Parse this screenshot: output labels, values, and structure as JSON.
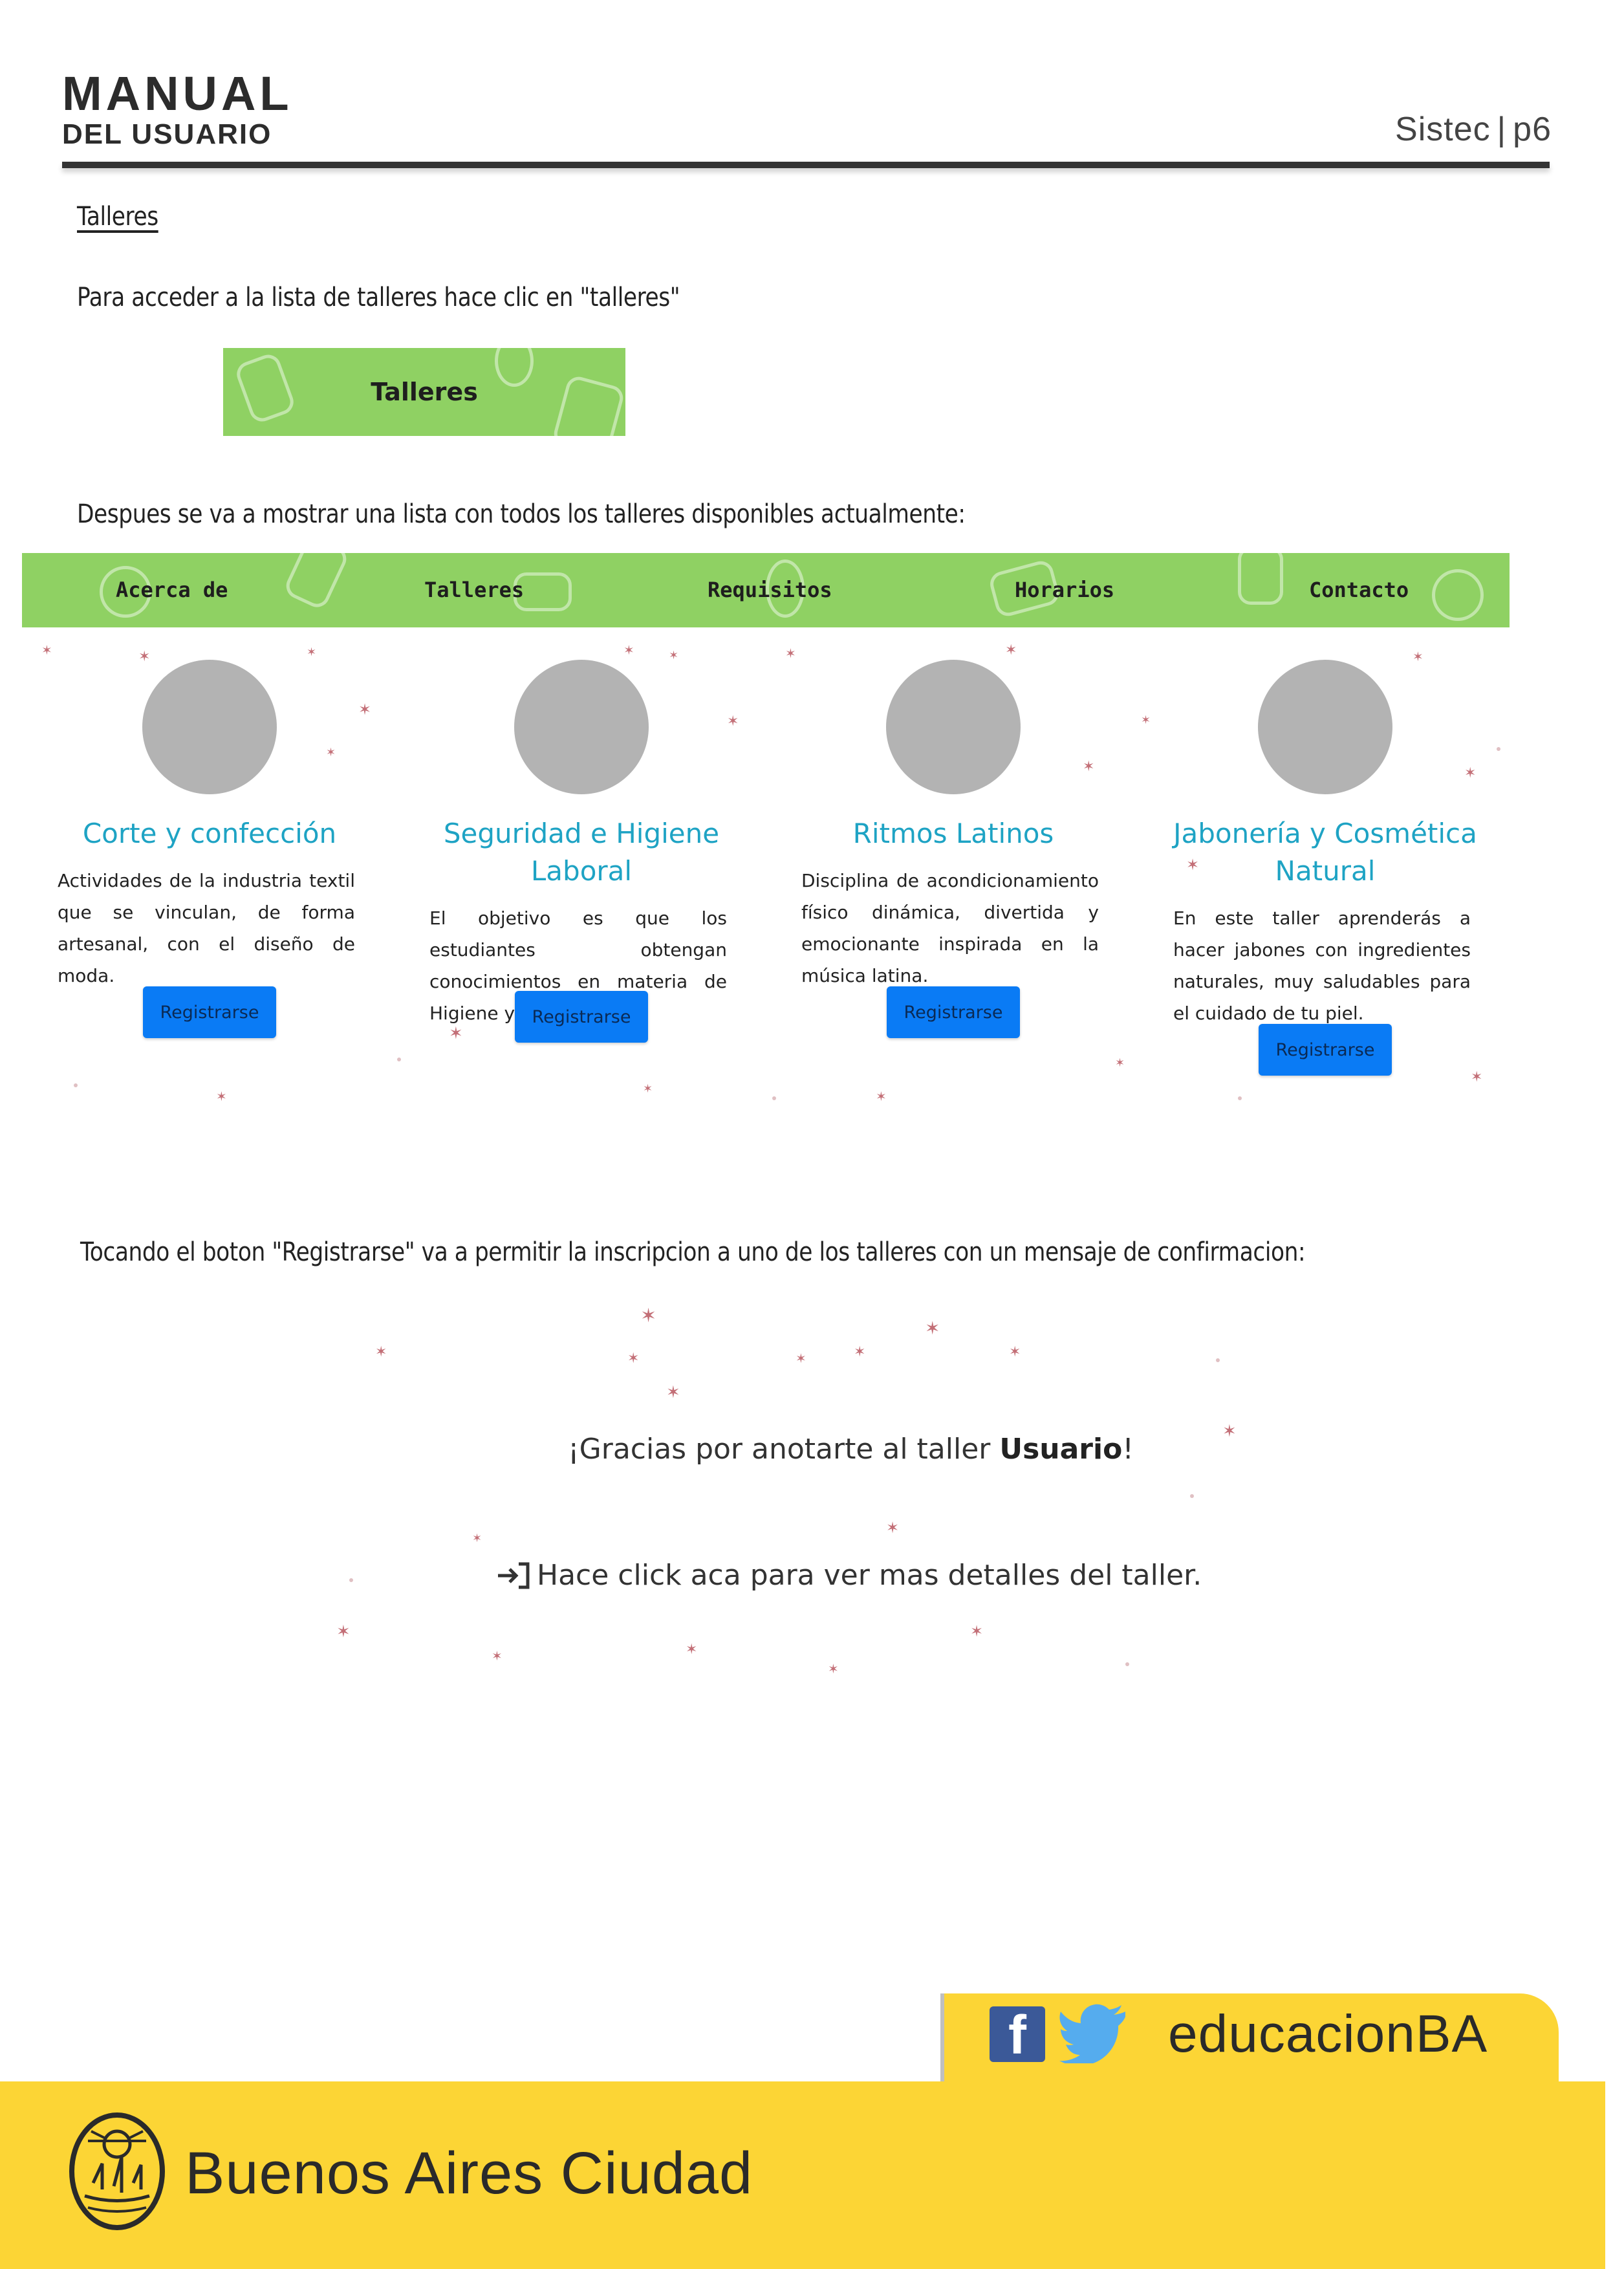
{
  "header": {
    "manual_line1": "MANUAL",
    "manual_line2": "DEL USUARIO",
    "app_name": "Sistec",
    "separator": "|",
    "page": "p6"
  },
  "section": {
    "title": "Talleres",
    "intro": "Para acceder a la lista de talleres hace clic en \"talleres\"",
    "button_label": "Talleres",
    "list_intro": "Despues se va a mostrar una lista con todos los talleres disponibles actualmente:",
    "confirm_intro": "Tocando el boton \"Registrarse\" va a permitir la inscripcion a uno de los talleres con un mensaje de confirmacion:"
  },
  "site": {
    "nav": [
      "Acerca de",
      "Talleres",
      "Requisitos",
      "Horarios",
      "Contacto"
    ],
    "cards": [
      {
        "title": "Corte y confección",
        "description": "Actividades de la industria textil que se vinculan, de forma artesanal, con el diseño de moda.",
        "button": "Registrarse"
      },
      {
        "title": "Seguridad e Higiene Laboral",
        "description": "El objetivo es que los estudiantes obtengan conocimientos en materia de Higiene y Seguridad",
        "button": "Registrarse"
      },
      {
        "title": "Ritmos Latinos",
        "description": "Disciplina de acondicionamiento físico dinámica, divertida y emocionante inspirada en la música latina.",
        "button": "Registrarse"
      },
      {
        "title": "Jabonería y Cosmética Natural",
        "description": "En este taller aprenderás a hacer jabones con ingredientes naturales, muy saludables para el cuidado de tu piel.",
        "button": "Registrarse"
      }
    ],
    "colors": {
      "nav_green": "#8fd163",
      "card_title": "#1ea3c4",
      "button_blue": "#0a7bf5"
    }
  },
  "confirmation": {
    "message_prefix": "¡Gracias por anotarte al taller ",
    "message_user": "Usuario",
    "message_suffix": "!",
    "link_icon": "sign-in-arrow-icon",
    "link_text": "Hace click aca para ver mas detalles del taller."
  },
  "footer": {
    "social_handle": "educacionBA",
    "facebook_icon": "facebook-icon",
    "twitter_icon": "twitter-icon",
    "city_name": "Buenos Aires Ciudad",
    "seal_icon": "city-seal-icon",
    "accent": "#fcd535"
  }
}
